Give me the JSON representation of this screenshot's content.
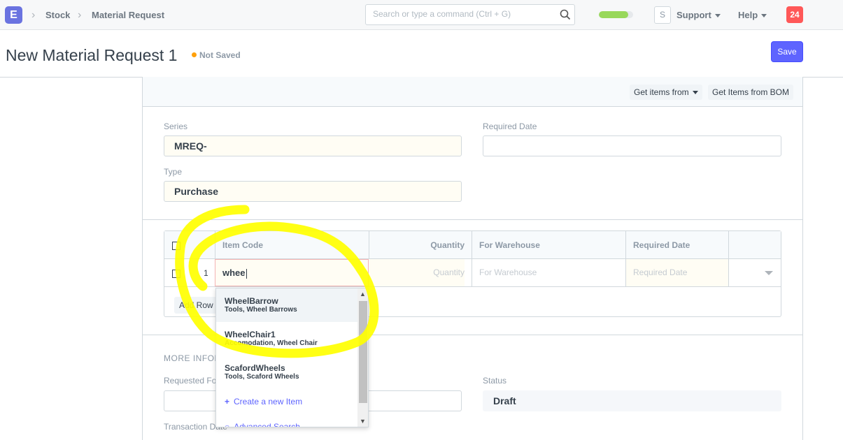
{
  "navbar": {
    "logo_letter": "E",
    "breadcrumbs": [
      "Stock",
      "Material Request"
    ],
    "search_placeholder": "Search or type a command (Ctrl + G)",
    "progress_fraction": 0.85,
    "avatar_letter": "S",
    "support_label": "Support",
    "help_label": "Help",
    "notification_count": "24"
  },
  "page": {
    "title": "New Material Request 1",
    "status": "Not Saved",
    "save_label": "Save"
  },
  "toolbar": {
    "get_items_from": "Get items from",
    "get_items_bom": "Get Items from BOM"
  },
  "fields": {
    "series_label": "Series",
    "series_value": "MREQ-",
    "required_date_label": "Required Date",
    "required_date_value": "",
    "type_label": "Type",
    "type_value": "Purchase"
  },
  "grid": {
    "headers": [
      "Item Code",
      "Quantity",
      "For Warehouse",
      "Required Date"
    ],
    "row": {
      "index": "1",
      "item_code": "whee",
      "quantity_placeholder": "Quantity",
      "warehouse_placeholder": "For Warehouse",
      "date_placeholder": "Required Date"
    },
    "add_row_label": "Add Row"
  },
  "more_info": {
    "section_title": "MORE INFORMATION",
    "requested_for_label": "Requested For",
    "status_label": "Status",
    "status_value": "Draft",
    "transaction_date_label": "Transaction Date"
  },
  "autocomplete": {
    "items": [
      {
        "title": "WheelBarrow",
        "subtitle": "Tools, Wheel Barrows"
      },
      {
        "title": "WheelChair1",
        "subtitle": "Accomodation, Wheel Chair"
      },
      {
        "title": "ScafordWheels",
        "subtitle": "Tools, Scaford Wheels"
      }
    ],
    "create_label": "Create a new Item",
    "advanced_label": "Advanced Search"
  },
  "colors": {
    "primary": "#5e64ff",
    "highlight": "#ffff00",
    "notification": "#ff5858",
    "progress": "#98d85b"
  }
}
